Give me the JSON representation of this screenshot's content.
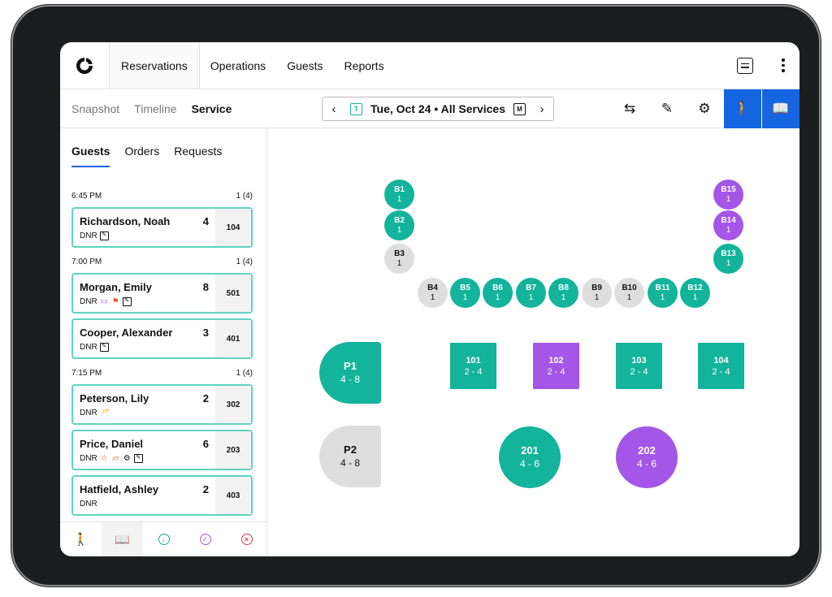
{
  "nav": {
    "tabs": [
      "Reservations",
      "Operations",
      "Guests",
      "Reports"
    ],
    "active_tab": "Reservations"
  },
  "subnav": {
    "tabs": [
      "Snapshot",
      "Timeline",
      "Service"
    ],
    "active_tab": "Service",
    "date_label": "Tue, Oct 24 • All Services",
    "cal_left_letter": "T",
    "cal_right_letter": "M",
    "prev": "‹",
    "next": "›"
  },
  "left_panel": {
    "tabs": [
      "Guests",
      "Orders",
      "Requests"
    ],
    "active_tab": "Guests",
    "slots": [
      {
        "time": "6:45 PM",
        "count": "1 (4)",
        "guests": [
          {
            "name": "Richardson, Noah",
            "party": "4",
            "tag": "DNR",
            "table": "104",
            "icons": [
              "note-icon"
            ]
          }
        ]
      },
      {
        "time": "7:00 PM",
        "count": "1 (4)",
        "guests": [
          {
            "name": "Morgan, Emily",
            "party": "8",
            "tag": "DNR",
            "table": "501",
            "icons": [
              "cake-icon",
              "flag-icon",
              "note-icon"
            ]
          },
          {
            "name": "Cooper, Alexander",
            "party": "3",
            "tag": "DNR",
            "table": "401",
            "icons": [
              "note-icon"
            ]
          }
        ]
      },
      {
        "time": "7:15 PM",
        "count": "1 (4)",
        "guests": [
          {
            "name": "Peterson, Lily",
            "party": "2",
            "tag": "DNR",
            "table": "302",
            "icons": [
              "toast-icon"
            ]
          },
          {
            "name": "Price, Daniel",
            "party": "6",
            "tag": "DNR",
            "table": "203",
            "icons": [
              "star-icon",
              "wine-icon",
              "gear-icon",
              "note-icon"
            ]
          },
          {
            "name": "Hatfield, Ashley",
            "party": "2",
            "tag": "DNR",
            "table": "403",
            "icons": []
          }
        ]
      }
    ],
    "bottom_icons": [
      "walk-in-icon",
      "book-icon",
      "download-icon",
      "check-icon",
      "cancel-icon"
    ]
  },
  "floor": {
    "bars": [
      {
        "id": "B1",
        "seats": "1",
        "status": "teal"
      },
      {
        "id": "B2",
        "seats": "1",
        "status": "teal"
      },
      {
        "id": "B3",
        "seats": "1",
        "status": "grey"
      },
      {
        "id": "B4",
        "seats": "1",
        "status": "grey"
      },
      {
        "id": "B5",
        "seats": "1",
        "status": "teal"
      },
      {
        "id": "B6",
        "seats": "1",
        "status": "teal"
      },
      {
        "id": "B7",
        "seats": "1",
        "status": "teal"
      },
      {
        "id": "B8",
        "seats": "1",
        "status": "teal"
      },
      {
        "id": "B9",
        "seats": "1",
        "status": "grey"
      },
      {
        "id": "B10",
        "seats": "1",
        "status": "grey"
      },
      {
        "id": "B11",
        "seats": "1",
        "status": "teal"
      },
      {
        "id": "B12",
        "seats": "1",
        "status": "teal"
      },
      {
        "id": "B13",
        "seats": "1",
        "status": "teal"
      },
      {
        "id": "B14",
        "seats": "1",
        "status": "purple"
      },
      {
        "id": "B15",
        "seats": "1",
        "status": "purple"
      }
    ],
    "tables": [
      {
        "id": "P1",
        "seats": "4 - 8",
        "status": "teal",
        "shape": "half"
      },
      {
        "id": "101",
        "seats": "2 - 4",
        "status": "teal",
        "shape": "square"
      },
      {
        "id": "102",
        "seats": "2 - 4",
        "status": "purple",
        "shape": "square"
      },
      {
        "id": "103",
        "seats": "2 - 4",
        "status": "teal",
        "shape": "square"
      },
      {
        "id": "104",
        "seats": "2 - 4",
        "status": "teal",
        "shape": "square"
      },
      {
        "id": "P2",
        "seats": "4 - 8",
        "status": "grey",
        "shape": "half"
      },
      {
        "id": "201",
        "seats": "4 - 6",
        "status": "teal",
        "shape": "round"
      },
      {
        "id": "202",
        "seats": "4 - 6",
        "status": "purple",
        "shape": "round"
      }
    ]
  },
  "colors": {
    "teal": "#14b39c",
    "purple": "#a456e6",
    "grey": "#dedede",
    "accent_blue": "#1565e0",
    "card_border": "#5fd4c0"
  }
}
